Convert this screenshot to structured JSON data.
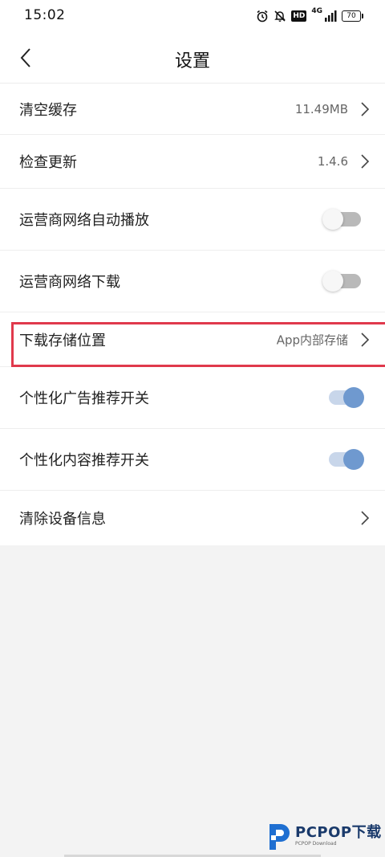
{
  "status_bar": {
    "time": "15:02",
    "icons": [
      "alarm-icon",
      "mute-bell-icon",
      "hd-icon",
      "signal-4g-icon",
      "battery-icon"
    ],
    "hd_label": "HD",
    "network_label": "4G",
    "battery_level": "70"
  },
  "header": {
    "title": "设置",
    "back_icon": "chevron-left-icon"
  },
  "settings": {
    "items": [
      {
        "label": "清空缓存",
        "value": "11.49MB",
        "control": "chevron"
      },
      {
        "label": "检查更新",
        "value": "1.4.6",
        "control": "chevron"
      },
      {
        "label": "运营商网络自动播放",
        "control": "toggle",
        "state": "off"
      },
      {
        "label": "运营商网络下载",
        "control": "toggle",
        "state": "off"
      },
      {
        "label": "下载存储位置",
        "value": "App内部存储",
        "control": "chevron",
        "highlighted": true
      },
      {
        "label": "个性化广告推荐开关",
        "control": "toggle",
        "state": "on"
      },
      {
        "label": "个性化内容推荐开关",
        "control": "toggle",
        "state": "on"
      },
      {
        "label": "清除设备信息",
        "control": "chevron"
      }
    ]
  },
  "colors": {
    "highlight": "#e0394c",
    "toggle_on": "#6f99cf",
    "toggle_off": "#b9b9b9",
    "background": "#f3f3f3"
  },
  "watermark": {
    "brand": "PCPOP下载",
    "sub": "PCPOP Download"
  }
}
